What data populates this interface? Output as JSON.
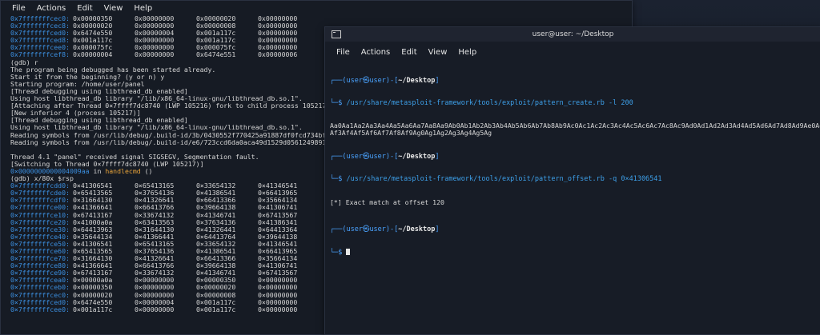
{
  "left_terminal": {
    "menu": [
      "File",
      "Actions",
      "Edit",
      "View",
      "Help"
    ],
    "top_rows": [
      {
        "addr": "0x7fffffffcec0:",
        "v": [
          "0x00000350",
          "0x00000000",
          "0x00000020",
          "0x00000000"
        ]
      },
      {
        "addr": "0x7fffffffcec8:",
        "v": [
          "0x00000020",
          "0x00000000",
          "0x00000008",
          "0x00000000"
        ]
      },
      {
        "addr": "0x7fffffffced0:",
        "v": [
          "0x6474e550",
          "0x00000004",
          "0x001a117c",
          "0x00000000"
        ]
      },
      {
        "addr": "0x7fffffffced8:",
        "v": [
          "0x001a117c",
          "0x00000000",
          "0x001a117c",
          "0x00000000"
        ]
      },
      {
        "addr": "0x7fffffffcee0:",
        "v": [
          "0x000075fc",
          "0x00000000",
          "0x000075fc",
          "0x00000000"
        ]
      },
      {
        "addr": "0x7fffffffcef8:",
        "v": [
          "0x00000004",
          "0x00000000",
          "0x6474e551",
          "0x00000006"
        ]
      }
    ],
    "log": [
      "(gdb) r",
      "The program being debugged has been started already.",
      "Start it from the beginning? (y or n) y",
      "Starting program: /home/user/panel",
      "[Thread debugging using libthread_db enabled]",
      "Using host libthread_db library \"/lib/x86_64-linux-gnu/libthread_db.so.1\".",
      "[Attaching after Thread 0×7ffff7dc8740 (LWP 105216) fork to child process 105217]",
      "[New inferior 4 (process 105217)]",
      "[Thread debugging using libthread_db enabled]",
      "Using host libthread_db library \"/lib/x86_64-linux-gnu/libthread_db.so.1\".",
      "Reading symbols from /usr/lib/debug/.build-id/3b/0430552f770425a91887df0fcd734bf3",
      "Reading symbols from /usr/lib/debug/.build-id/e6/723ccd6da0aca49d1529d0561249891e2",
      "",
      "Thread 4.1 \"panel\" received signal SIGSEGV, Segmentation fault.",
      "[Switching to Thread 0×7ffff7dc8740 (LWP 105217)]"
    ],
    "crash_addr": "0×0000000000004009aa",
    "crash_in": " in ",
    "crash_fn": "handlecmd",
    "crash_tail": " ()",
    "examine_cmd": "(gdb) x/80x $rsp",
    "stack_rows": [
      {
        "addr": "0×7fffffffcdd0:",
        "v": [
          "0×41306541",
          "0×65413165",
          "0×33654132",
          "0×41346541"
        ]
      },
      {
        "addr": "0×7fffffffcde0:",
        "v": [
          "0×65413565",
          "0×37654136",
          "0×41386541",
          "0×66413965"
        ]
      },
      {
        "addr": "0×7fffffffcdf0:",
        "v": [
          "0×31664130",
          "0×41326641",
          "0×66413366",
          "0×35664134"
        ]
      },
      {
        "addr": "0×7fffffffce00:",
        "v": [
          "0×41366641",
          "0×66413766",
          "0×39664138",
          "0×41306741"
        ]
      },
      {
        "addr": "0×7fffffffce10:",
        "v": [
          "0×67413167",
          "0×33674132",
          "0×41346741",
          "0×67413567"
        ]
      },
      {
        "addr": "0×7fffffffce20:",
        "v": [
          "0×41000a0a",
          "0×63413563",
          "0×37634136",
          "0×41386341"
        ]
      },
      {
        "addr": "0×7fffffffce30:",
        "v": [
          "0×64413963",
          "0×31644130",
          "0×41326441",
          "0×64413364"
        ]
      },
      {
        "addr": "0×7fffffffce40:",
        "v": [
          "0×35644134",
          "0×41366441",
          "0×64413764",
          "0×39644138"
        ]
      },
      {
        "addr": "0×7fffffffce50:",
        "v": [
          "0×41306541",
          "0×65413165",
          "0×33654132",
          "0×41346541"
        ]
      },
      {
        "addr": "0×7fffffffce60:",
        "v": [
          "0×65413565",
          "0×37654136",
          "0×41386541",
          "0×66413965"
        ]
      },
      {
        "addr": "0×7fffffffce70:",
        "v": [
          "0×31664130",
          "0×41326641",
          "0×66413366",
          "0×35664134"
        ]
      },
      {
        "addr": "0×7fffffffce80:",
        "v": [
          "0×41366641",
          "0×66413766",
          "0×39664138",
          "0×41306741"
        ]
      },
      {
        "addr": "0×7fffffffce90:",
        "v": [
          "0×67413167",
          "0×33674132",
          "0×41346741",
          "0×67413567"
        ]
      },
      {
        "addr": "0×7fffffffcea0:",
        "v": [
          "0×00000a0a",
          "0×00000000",
          "0×00000350",
          "0×00000000"
        ]
      },
      {
        "addr": "0×7fffffffceb0:",
        "v": [
          "0×00000350",
          "0×00000000",
          "0×00000020",
          "0×00000000"
        ]
      },
      {
        "addr": "0×7fffffffcec0:",
        "v": [
          "0×00000020",
          "0×00000000",
          "0×00000008",
          "0×00000000"
        ]
      },
      {
        "addr": "0×7fffffffced0:",
        "v": [
          "0×6474e550",
          "0×00000004",
          "0×001a117c",
          "0×00000000"
        ]
      },
      {
        "addr": "0×7fffffffcee0:",
        "v": [
          "0×001a117c",
          "0×00000000",
          "0×001a117c",
          "0×00000000"
        ]
      }
    ]
  },
  "right_terminal": {
    "title": "user@user: ~/Desktop",
    "menu": [
      "File",
      "Actions",
      "Edit",
      "View",
      "Help"
    ],
    "prompt_user": "┌──(user㉿user)-[",
    "prompt_path": "~/Desktop",
    "prompt_close": "]",
    "prompt_arrow": "└─$ ",
    "cmd1": "/usr/share/metasploit-framework/tools/exploit/pattern_create.rb -l 200",
    "out1a": "Aa0Aa1Aa2Aa3Aa4Aa5Aa6Aa7Aa8Aa9Ab0Ab1Ab2Ab3Ab4Ab5Ab6Ab7Ab8Ab9Ac0Ac1Ac2Ac3Ac4Ac5Ac6Ac7Ac8Ac9Ad0Ad1Ad2Ad3Ad4Ad5Ad6Ad7Ad8Ad9Ae0Ae1Ae",
    "out1b": "Af3Af4Af5Af6Af7Af8Af9Ag0Ag1Ag2Ag3Ag4Ag5Ag",
    "cmd2": "/usr/share/metasploit-framework/tools/exploit/pattern_offset.rb -q 0×41306541",
    "out2": "[*] Exact match at offset 120"
  },
  "colors": {
    "address": "#3b8fe0",
    "function": "#e7a33a",
    "prompt": "#4aa3ff"
  }
}
